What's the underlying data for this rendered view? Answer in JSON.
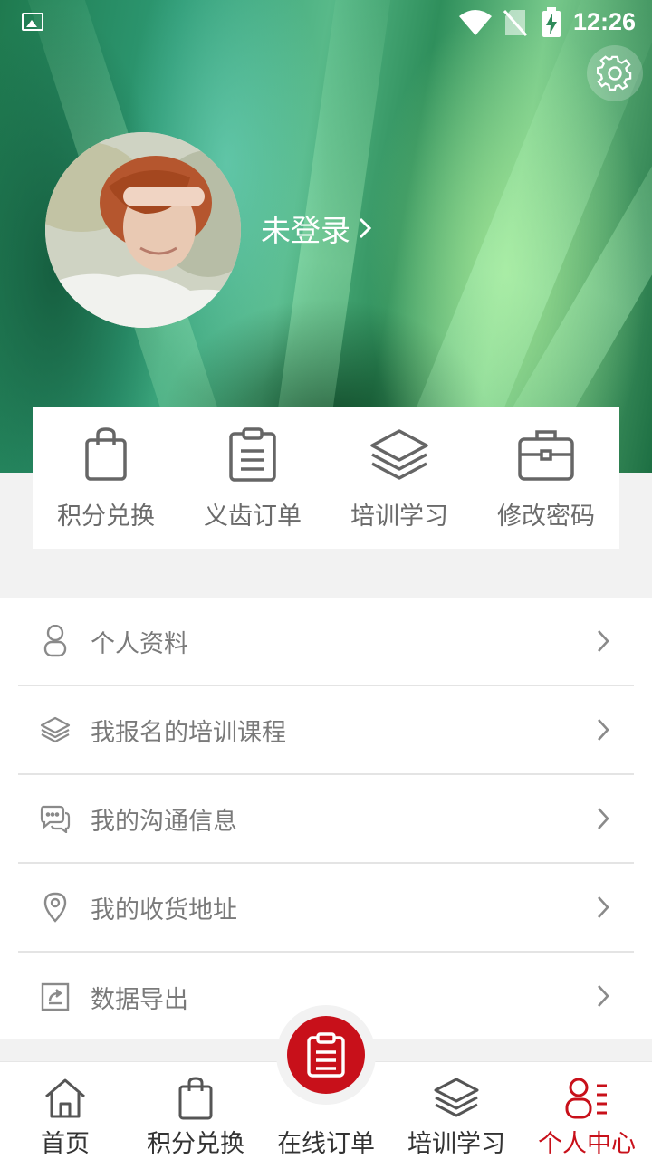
{
  "status_bar": {
    "time": "12:26"
  },
  "profile": {
    "login_text": "未登录"
  },
  "quick_actions": [
    {
      "label": "积分兑换",
      "icon": "shopping-bag-icon"
    },
    {
      "label": "义齿订单",
      "icon": "clipboard-icon"
    },
    {
      "label": "培训学习",
      "icon": "layers-icon"
    },
    {
      "label": "修改密码",
      "icon": "briefcase-icon"
    }
  ],
  "menu": [
    {
      "label": "个人资料",
      "icon": "person-icon"
    },
    {
      "label": "我报名的培训课程",
      "icon": "layers-icon"
    },
    {
      "label": "我的沟通信息",
      "icon": "chat-icon"
    },
    {
      "label": "我的收货地址",
      "icon": "location-pin-icon"
    },
    {
      "label": "数据导出",
      "icon": "export-icon"
    }
  ],
  "tabs": [
    {
      "label": "首页",
      "icon": "home-icon"
    },
    {
      "label": "积分兑换",
      "icon": "shopping-bag-icon"
    },
    {
      "label": "在线订单",
      "icon": "clipboard-icon"
    },
    {
      "label": "培训学习",
      "icon": "layers-icon"
    },
    {
      "label": "个人中心",
      "icon": "profile-list-icon",
      "active": true
    }
  ],
  "colors": {
    "accent": "#c8101a",
    "text_muted": "#7a7a7a",
    "background": "#f2f2f2"
  }
}
